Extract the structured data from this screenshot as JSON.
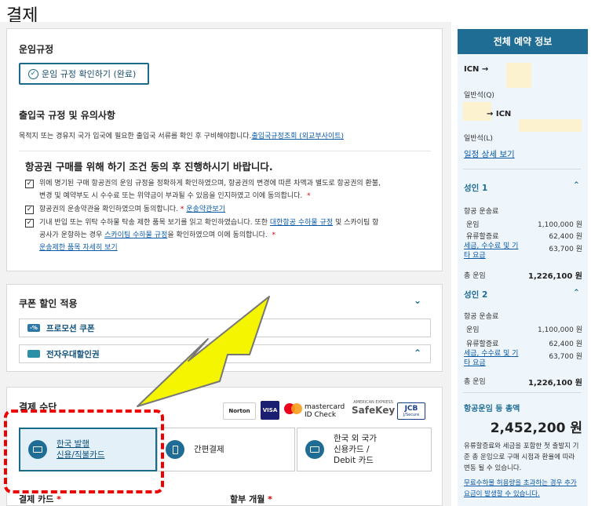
{
  "page": {
    "title": "결제"
  },
  "carriage_rules": {
    "heading": "운임규정",
    "confirm_button": "운임 규정 확인하기 (완료)"
  },
  "entry_rules": {
    "heading": "출입국 규정 및 유의사항",
    "description": "목적지 또는 경유지 국가 입국에 필요한 출입국 서류를 확인 후 구비해야합니다.",
    "link": "출입국규정조회 (외교부사이트)"
  },
  "agreement": {
    "heading": "항공권 구매를 위해 하기 조건 동의 후 진행하시기 바랍니다.",
    "item1_line1": "위에 명기된 구매 항공권의 운임 규정을 정확하게 확인하였으며, 항공권의 변경에 따른 차액과 별도로 항공권의 환불,",
    "item1_line2": "변경 및 예약부도 시 수수료 또는 위약금이 부과될 수 있음을 인지하였고 이에 동의합니다.",
    "item2_text": "항공권의 운송약관을 확인하였으며 동의합니다.",
    "item2_link": "운송약관보기",
    "item3_line1a": "기내 반입 또는 위탁 수하물 탁송 제한 품목 보기를 읽고 확인하였습니다. 또한 ",
    "item3_link1": "대한항공 수하물 규정",
    "item3_line1b": " 및 스카이팀 항",
    "item3_line2a": "공사가 운항하는 경우 ",
    "item3_link2": "스카이팀 수하물 규정",
    "item3_line2b": "을 확인하였으며 이에 동의합니다.",
    "item3_link3": "운송제한 품목 자세히 보기",
    "required_mark": "*"
  },
  "coupon": {
    "heading": "쿠폰 할인 적용",
    "promo_label": "프로모션 쿠폰",
    "promo_icon_text": "-%",
    "voucher_label": "전자우대할인권"
  },
  "payment": {
    "heading": "결제 수단",
    "methods": [
      {
        "line1": "한국 발행",
        "line2": "신용/직불카드",
        "selected": true
      },
      {
        "line1": "간편결제",
        "line2": "",
        "selected": false
      },
      {
        "line1": "한국 외 국가",
        "line2": "신용카드 /",
        "line3": "Debit 카드",
        "selected": false
      }
    ],
    "card_label": "결제 카드",
    "installment_label": "할부 개월",
    "logos": {
      "norton": "Norton",
      "visa": "VISA",
      "mastercard_1": "mastercard",
      "mastercard_2": "ID Check",
      "safekey_top": "AMERICAN EXPRESS",
      "safekey": "SafeKey",
      "jcb": "JCB",
      "jcb_sub": "J/Secure"
    }
  },
  "summary": {
    "header": "전체 예약 정보",
    "seg1_route": "ICN →",
    "seg1_class": "일반석(Q)",
    "seg2_route": "→ ICN",
    "seg2_class": "일반석(L)",
    "itinerary_link": "일정 상세 보기",
    "passengers": [
      {
        "label": "성인 1",
        "fare_group": "항공 운송료",
        "fare_label": "운임",
        "fare": "1,100,000 원",
        "fuel_label": "유류할증료",
        "fuel": "62,400 원",
        "tax_label_1": "세금, 수수료 및 기",
        "tax_label_2": "타 요금",
        "tax": "63,700 원",
        "total_label": "총 운임",
        "total": "1,226,100 원"
      },
      {
        "label": "성인 2",
        "fare_group": "항공 운송료",
        "fare_label": "운임",
        "fare": "1,100,000 원",
        "fuel_label": "유류할증료",
        "fuel": "62,400 원",
        "tax_label_1": "세금, 수수료 및 기",
        "tax_label_2": "타 요금",
        "tax": "63,700 원",
        "total_label": "총 운임",
        "total": "1,226,100 원"
      }
    ],
    "grand_total_label": "항공운임 등 총액",
    "grand_total": "2,452,200 원",
    "notice": "유류할증료와 세금을 포함한 첫 출발지 기준 총 운임으로 구매 시점과 환율에 따라 변동 될 수 있습니다.",
    "notice_link": "무료수하물 허용량을 초과하는 경우 추가 요금이 발생할 수 있습니다."
  },
  "colors": {
    "accent": "#1f6d95",
    "highlight_box": "#e00000",
    "bolt": "#f5f500"
  }
}
